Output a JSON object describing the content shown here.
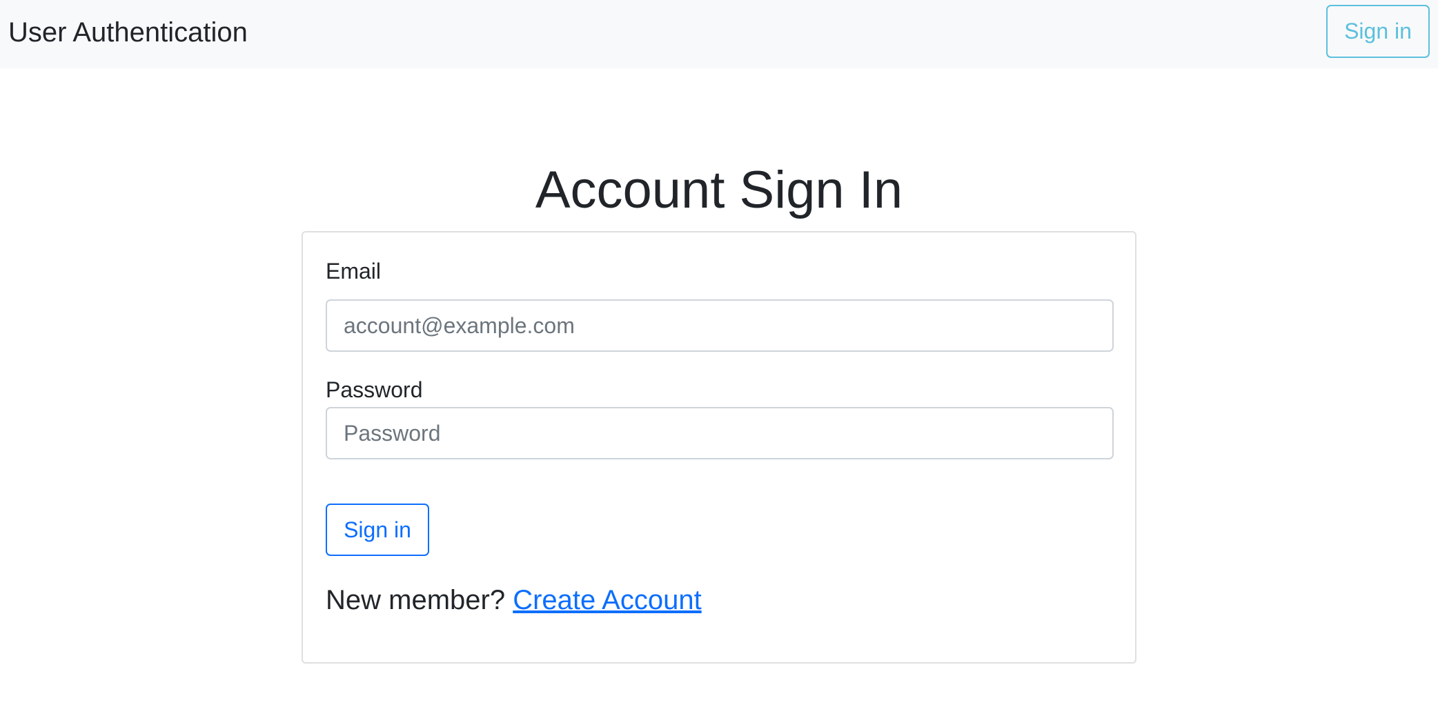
{
  "navbar": {
    "brand": "User Authentication",
    "signin_label": "Sign in"
  },
  "page": {
    "title": "Account Sign In"
  },
  "form": {
    "email_label": "Email",
    "email_placeholder": "account@example.com",
    "email_value": "",
    "password_label": "Password",
    "password_placeholder": "Password",
    "password_value": "",
    "submit_label": "Sign in",
    "new_member_text": "New member?",
    "create_account_label": "Create Account"
  },
  "colors": {
    "navbar_bg": "#f8f9fa",
    "info_outline": "#5bc0de",
    "primary": "#0d6efd",
    "text": "#212529",
    "placeholder": "#6c757d"
  }
}
